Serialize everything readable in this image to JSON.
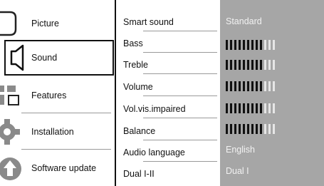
{
  "menu": {
    "items": [
      {
        "label": "Picture",
        "icon": "tv-screen-icon",
        "selected": false
      },
      {
        "label": "Sound",
        "icon": "speaker-icon",
        "selected": true
      },
      {
        "label": "Features",
        "icon": "features-grid-icon",
        "selected": false
      },
      {
        "label": "Installation",
        "icon": "gear-icon",
        "selected": false
      },
      {
        "label": "Software update",
        "icon": "update-arrow-icon",
        "selected": false
      }
    ]
  },
  "sound_settings": {
    "items": [
      {
        "label": "Smart sound"
      },
      {
        "label": "Bass"
      },
      {
        "label": "Treble"
      },
      {
        "label": "Volume"
      },
      {
        "label": "Vol.vis.impaired"
      },
      {
        "label": "Balance"
      },
      {
        "label": "Audio language"
      },
      {
        "label": "Dual I-II"
      }
    ]
  },
  "values": {
    "smart_sound": "Standard",
    "level_bars": [
      {
        "setting": "Bass",
        "filled": 9,
        "total": 12
      },
      {
        "setting": "Treble",
        "filled": 9,
        "total": 12
      },
      {
        "setting": "Volume",
        "filled": 9,
        "total": 12
      },
      {
        "setting": "Vol.vis.impaired",
        "filled": 9,
        "total": 12
      },
      {
        "setting": "Balance",
        "filled": 9,
        "total": 12
      }
    ],
    "audio_language": "English",
    "dual": "Dual I"
  },
  "colors": {
    "value_panel": "#a6a6a6",
    "text": "#111111",
    "value_text": "#f2f2f2"
  }
}
